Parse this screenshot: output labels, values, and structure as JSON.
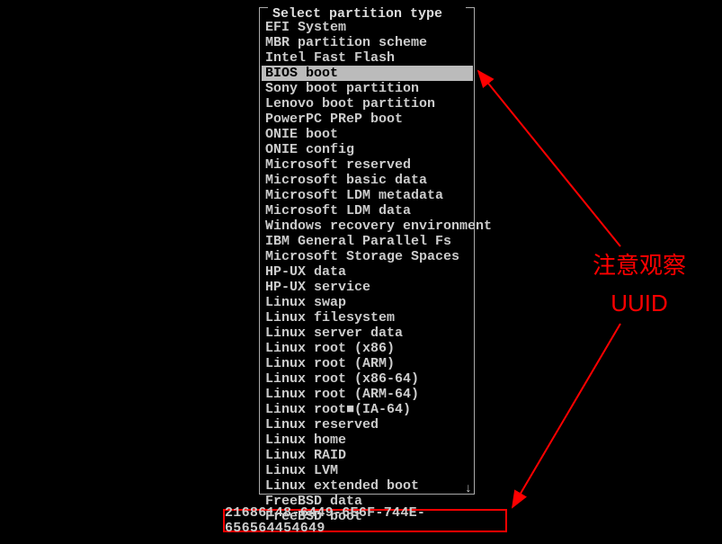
{
  "menu": {
    "title": "Select partition type",
    "items": [
      {
        "label": "EFI System",
        "selected": false
      },
      {
        "label": "MBR partition scheme",
        "selected": false
      },
      {
        "label": "Intel Fast Flash",
        "selected": false
      },
      {
        "label": "BIOS boot",
        "selected": true
      },
      {
        "label": "Sony boot partition",
        "selected": false
      },
      {
        "label": "Lenovo boot partition",
        "selected": false
      },
      {
        "label": "PowerPC PReP boot",
        "selected": false
      },
      {
        "label": "ONIE boot",
        "selected": false
      },
      {
        "label": "ONIE config",
        "selected": false
      },
      {
        "label": "Microsoft reserved",
        "selected": false
      },
      {
        "label": "Microsoft basic data",
        "selected": false
      },
      {
        "label": "Microsoft LDM metadata",
        "selected": false
      },
      {
        "label": "Microsoft LDM data",
        "selected": false
      },
      {
        "label": "Windows recovery environment",
        "selected": false
      },
      {
        "label": "IBM General Parallel Fs",
        "selected": false
      },
      {
        "label": "Microsoft Storage Spaces",
        "selected": false
      },
      {
        "label": "HP-UX data",
        "selected": false
      },
      {
        "label": "HP-UX service",
        "selected": false
      },
      {
        "label": "Linux swap",
        "selected": false
      },
      {
        "label": "Linux filesystem",
        "selected": false
      },
      {
        "label": "Linux server data",
        "selected": false
      },
      {
        "label": "Linux root (x86)",
        "selected": false
      },
      {
        "label": "Linux root (ARM)",
        "selected": false
      },
      {
        "label": "Linux root (x86-64)",
        "selected": false
      },
      {
        "label": "Linux root (ARM-64)",
        "selected": false
      },
      {
        "label": "Linux root■(IA-64)",
        "selected": false
      },
      {
        "label": "Linux reserved",
        "selected": false
      },
      {
        "label": "Linux home",
        "selected": false
      },
      {
        "label": "Linux RAID",
        "selected": false
      },
      {
        "label": "Linux LVM",
        "selected": false
      },
      {
        "label": "Linux extended boot",
        "selected": false
      },
      {
        "label": "FreeBSD data",
        "selected": false
      },
      {
        "label": "FreeBSD boot",
        "selected": false
      }
    ],
    "scroll_indicator": "↓"
  },
  "uuid": "21686148-6449-6E6F-744E-656564454649",
  "annotation": {
    "line1": "注意观察",
    "line2": "UUID"
  }
}
